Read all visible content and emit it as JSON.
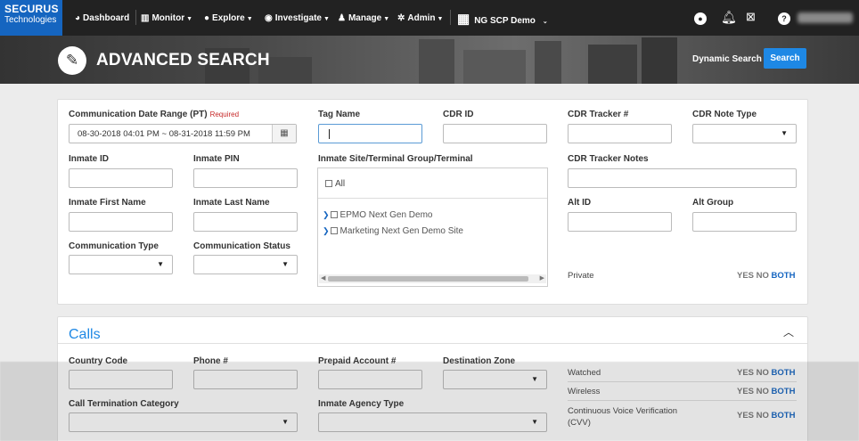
{
  "nav": {
    "logo_line1": "SECURUS",
    "logo_line2": "Technologies",
    "items": [
      {
        "label": "Dashboard",
        "icon": "dashboard-icon",
        "dropdown": false
      },
      {
        "label": "Monitor",
        "icon": "chart-icon",
        "dropdown": true
      },
      {
        "label": "Explore",
        "icon": "globe-icon",
        "dropdown": true
      },
      {
        "label": "Investigate",
        "icon": "eye-icon",
        "dropdown": true
      },
      {
        "label": "Manage",
        "icon": "user-icon",
        "dropdown": true
      },
      {
        "label": "Admin",
        "icon": "gear-icon",
        "dropdown": true
      }
    ],
    "site": "NG SCP Demo"
  },
  "banner": {
    "title": "ADVANCED SEARCH",
    "dynamic_search": "Dynamic Search",
    "search_button": "Search"
  },
  "form": {
    "date_range_label": "Communication Date Range (PT)",
    "required": "Required",
    "date_range_value": "08-30-2018 04:01 PM ~ 08-31-2018 11:59 PM",
    "tag_name": "Tag Name",
    "cdr_id": "CDR ID",
    "cdr_tracker": "CDR Tracker #",
    "cdr_note_type": "CDR Note Type",
    "inmate_id": "Inmate ID",
    "inmate_pin": "Inmate PIN",
    "site_label": "Inmate Site/Terminal Group/Terminal",
    "cdr_tracker_notes": "CDR Tracker Notes",
    "tree_all": "All",
    "tree_items": [
      "EPMO Next Gen Demo",
      "Marketing Next Gen Demo Site"
    ],
    "first_name": "Inmate First Name",
    "last_name": "Inmate Last Name",
    "alt_id": "Alt ID",
    "alt_group": "Alt Group",
    "comm_type": "Communication Type",
    "comm_status": "Communication Status",
    "private": "Private"
  },
  "tristate": {
    "yes": "YES",
    "no": "NO",
    "both": "BOTH"
  },
  "calls": {
    "title": "Calls",
    "country_code": "Country Code",
    "phone": "Phone #",
    "prepaid": "Prepaid Account #",
    "destination_zone": "Destination Zone",
    "watched": "Watched",
    "wireless": "Wireless",
    "termination": "Call Termination Category",
    "agency_type": "Inmate Agency Type",
    "cvv": "Continuous Voice Verification (CVV)"
  }
}
